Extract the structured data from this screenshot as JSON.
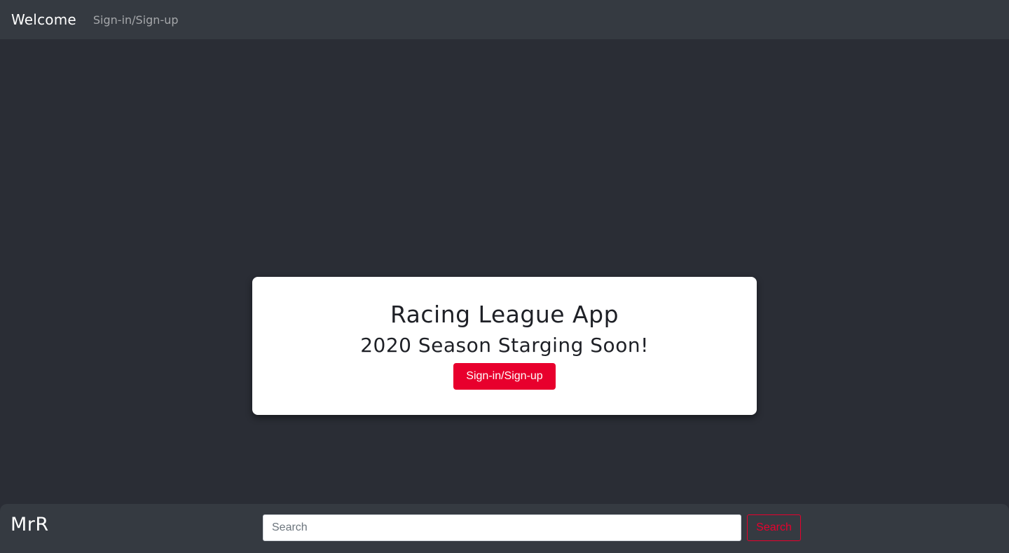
{
  "navbar": {
    "brand": "Welcome",
    "links": [
      {
        "label": "Sign-in/Sign-up"
      }
    ]
  },
  "hero": {
    "title": "Racing League App",
    "subtitle": "2020 Season Starging Soon!",
    "button_label": "Sign-in/Sign-up"
  },
  "footer": {
    "logo": "MrR",
    "search": {
      "placeholder": "Search",
      "value": "",
      "button_label": "Search"
    }
  },
  "colors": {
    "background": "#2a2d35",
    "navbar": "#353a41",
    "accent": "#e8002d",
    "card": "#ffffff"
  }
}
